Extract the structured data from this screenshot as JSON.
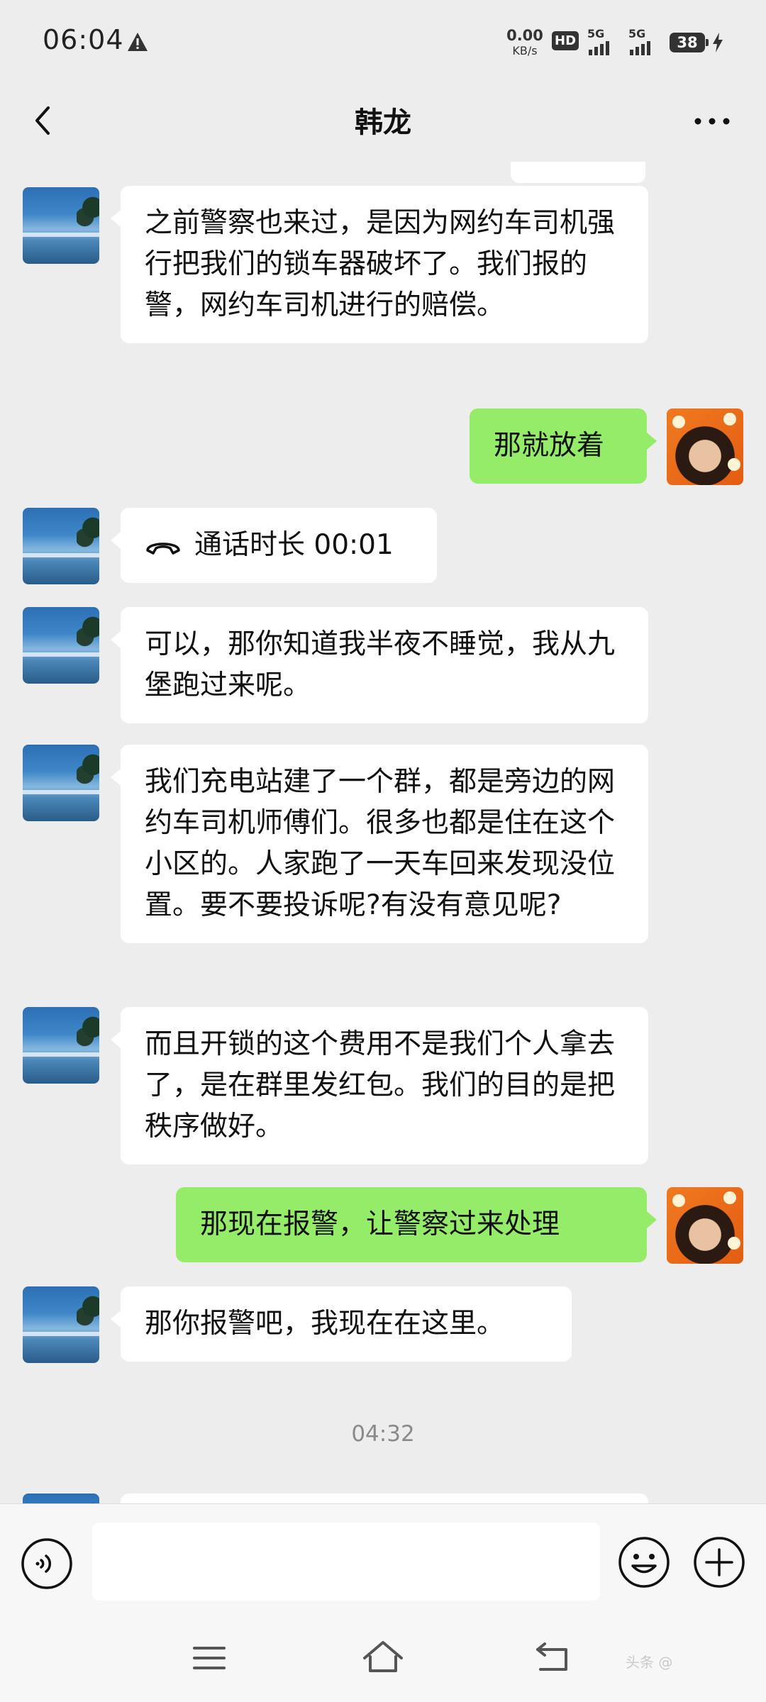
{
  "status_bar": {
    "time": "06:04",
    "net_speed_value": "0.00",
    "net_speed_unit": "KB/s",
    "hd_label": "HD",
    "signal1_label": "5G",
    "signal2_label": "5G",
    "battery_level": "38",
    "icons": [
      "warning-icon",
      "hd-icon",
      "signal-icon",
      "signal-icon",
      "battery-icon",
      "charging-icon"
    ]
  },
  "header": {
    "title": "韩龙",
    "icons": [
      "back-arrow-icon",
      "more-icon"
    ]
  },
  "messages": [
    {
      "side": "left",
      "text": "之前警察也来过，是因为网约车司机强行把我们的锁车器破坏了。我们报的警，网约车司机进行的赔偿。"
    },
    {
      "side": "right",
      "text": "那就放着"
    },
    {
      "side": "left",
      "type": "call",
      "text": "通话时长 00:01"
    },
    {
      "side": "left",
      "text": "可以，那你知道我半夜不睡觉，我从九堡跑过来呢。"
    },
    {
      "side": "left",
      "text": "我们充电站建了一个群，都是旁边的网约车司机师傅们。很多也都是住在这个小区的。人家跑了一天车回来发现没位置。要不要投诉呢?有没有意见呢?"
    },
    {
      "side": "left",
      "text": "而且开锁的这个费用不是我们个人拿去了，是在群里发红包。我们的目的是把秩序做好。"
    },
    {
      "side": "right",
      "text": "那现在报警，让警察过来处理"
    },
    {
      "side": "left",
      "text": "那你报警吧，我现在在这里。"
    }
  ],
  "timestamp": "04:32",
  "input_bar": {
    "placeholder": "",
    "icons": [
      "voice-icon",
      "emoji-icon",
      "add-icon"
    ]
  },
  "nav_bar": {
    "icons": [
      "menu-icon",
      "home-icon",
      "back-icon"
    ]
  },
  "watermark": "头条 @",
  "colors": {
    "background": "#ededed",
    "sent_bubble": "#95ec69",
    "received_bubble": "#ffffff",
    "timestamp_text": "#8a8a8a"
  }
}
